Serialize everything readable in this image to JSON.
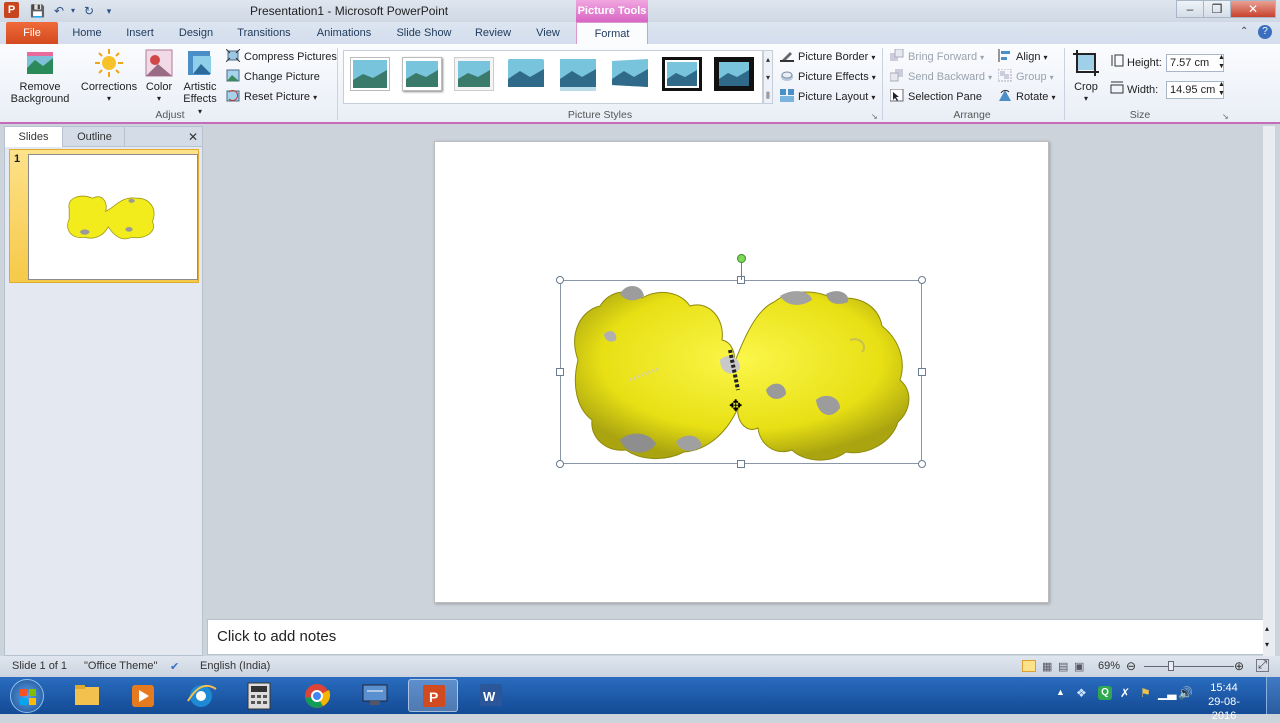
{
  "window": {
    "title": "Presentation1  -  Microsoft PowerPoint",
    "context_tab": "Picture Tools",
    "app_icon": "P",
    "controls": [
      "minimize-icon",
      "maximize-icon",
      "close-icon"
    ]
  },
  "tabs": [
    "File",
    "Home",
    "Insert",
    "Design",
    "Transitions",
    "Animations",
    "Slide Show",
    "Review",
    "View",
    "Format"
  ],
  "ribbon": {
    "adjust": {
      "remove_background_line1": "Remove",
      "remove_background_line2": "Background",
      "corrections": "Corrections",
      "color": "Color",
      "artistic_line1": "Artistic",
      "artistic_line2": "Effects",
      "compress": "Compress Pictures",
      "change": "Change Picture",
      "reset": "Reset Picture",
      "label": "Adjust"
    },
    "picture_styles": {
      "label": "Picture Styles",
      "border": "Picture Border",
      "effects": "Picture Effects",
      "layout": "Picture Layout"
    },
    "arrange": {
      "label": "Arrange",
      "bring_forward": "Bring Forward",
      "send_backward": "Send Backward",
      "selection_pane": "Selection Pane",
      "align": "Align",
      "group": "Group",
      "rotate": "Rotate"
    },
    "size": {
      "label": "Size",
      "crop": "Crop",
      "height_label": "Height:",
      "height_value": "7.57 cm",
      "width_label": "Width:",
      "width_value": "14.95 cm"
    }
  },
  "left_panel": {
    "tab_slides": "Slides",
    "tab_outline": "Outline",
    "slide_number": "1"
  },
  "notes_placeholder": "Click to add notes",
  "status": {
    "slide": "Slide 1 of 1",
    "theme": "\"Office Theme\"",
    "language": "English (India)",
    "zoom": "69%"
  },
  "taskbar": {
    "time": "15:44",
    "date": "29-08-2016"
  },
  "colors": {
    "file_tab": "#d24a1f",
    "context_pink": "#d866c4",
    "protein_yellow": "#f2ec1c",
    "taskbar": "#1b5aa8"
  }
}
